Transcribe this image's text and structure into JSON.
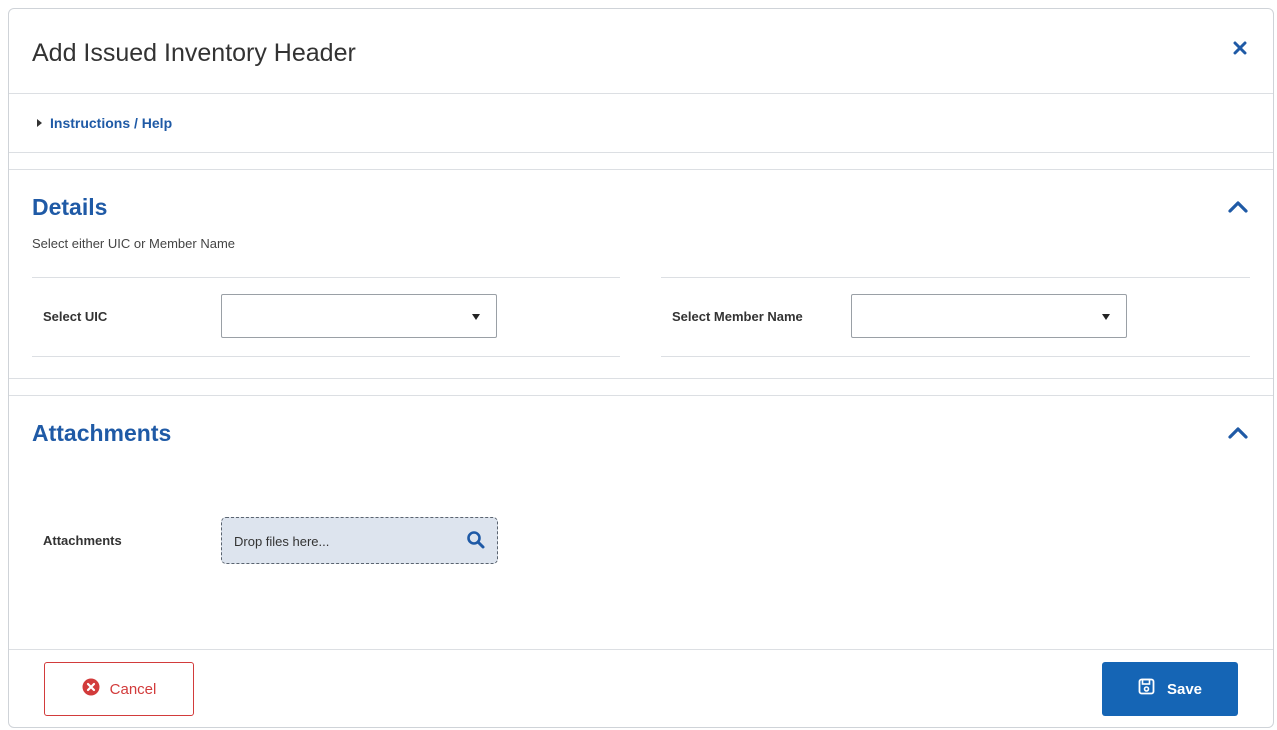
{
  "modal": {
    "title": "Add Issued Inventory Header",
    "close_icon": "close-icon"
  },
  "help": {
    "label": "Instructions / Help",
    "icon": "caret-right-icon"
  },
  "details": {
    "title": "Details",
    "subtitle": "Select either UIC or Member Name",
    "collapse_icon": "chevron-up-icon",
    "fields": {
      "uic": {
        "label": "Select UIC",
        "value": ""
      },
      "member": {
        "label": "Select Member Name",
        "value": ""
      }
    }
  },
  "attachments": {
    "title": "Attachments",
    "collapse_icon": "chevron-up-icon",
    "field_label": "Attachments",
    "dropzone_placeholder": "Drop files here...",
    "search_icon": "search-icon"
  },
  "footer": {
    "cancel_label": "Cancel",
    "save_label": "Save"
  },
  "colors": {
    "accent": "#1f5aa6",
    "save_bg": "#1565b5",
    "cancel": "#d23b3b",
    "dropzone_bg": "#dde4ee"
  }
}
